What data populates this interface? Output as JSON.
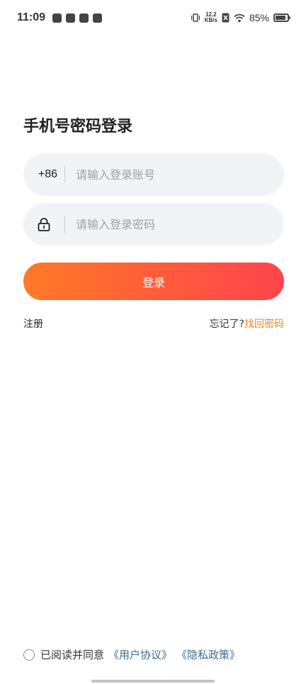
{
  "status_bar": {
    "time": "11:09",
    "speed_value": "12.2",
    "speed_unit": "KB/s",
    "battery_percent": "85%",
    "battery_level": 0.85
  },
  "page": {
    "title": "手机号密码登录"
  },
  "phone_field": {
    "prefix": "+86",
    "placeholder": "请输入登录账号",
    "value": ""
  },
  "password_field": {
    "icon": "lock-icon",
    "placeholder": "请输入登录密码",
    "value": ""
  },
  "login_button": {
    "label": "登录"
  },
  "links": {
    "register": "注册",
    "forgot_prefix": "忘记了?",
    "forgot_link": "找回密码"
  },
  "agreement": {
    "text": "已阅读并同意",
    "user_agreement": "《用户协议》",
    "privacy_policy": "《隐私政策》"
  },
  "colors": {
    "accent_start": "#ff7a28",
    "accent_end": "#ff444d",
    "link_orange": "#e8871e",
    "link_blue": "#3e6b8a",
    "field_bg": "#f1f3f7"
  }
}
